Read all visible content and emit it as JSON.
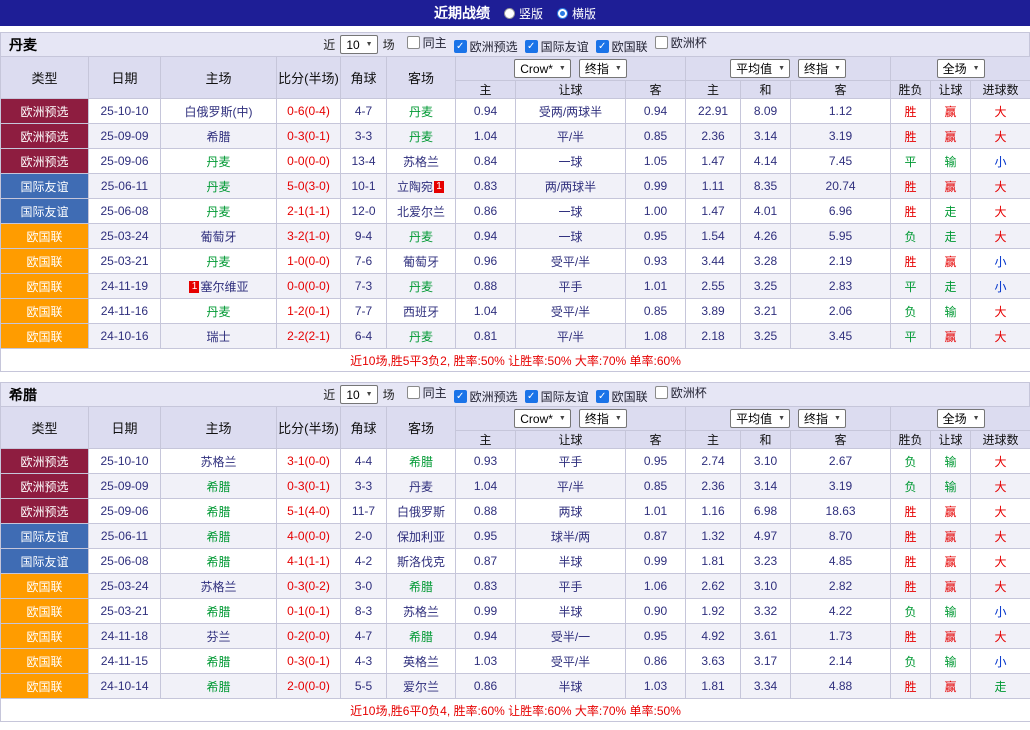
{
  "topbar": {
    "title": "近期战绩",
    "layout_options": [
      {
        "label": "竖版",
        "selected": false
      },
      {
        "label": "横版",
        "selected": true
      }
    ]
  },
  "table_head": {
    "type": "类型",
    "date": "日期",
    "home": "主场",
    "score": "比分(半场)",
    "corner": "角球",
    "away": "客场",
    "asia_selects": [
      "Crow*",
      "终指"
    ],
    "europe_selects": [
      "平均值",
      "终指"
    ],
    "result_select": "全场",
    "asia_sub": [
      "主",
      "让球",
      "客"
    ],
    "europe_sub": [
      "主",
      "和",
      "客"
    ],
    "result_sub": [
      "胜负",
      "让球",
      "进球数"
    ]
  },
  "colors": {
    "topbar_bg": "#1e1e96",
    "euro_qualifier_badge": "#8e1d40",
    "friendly_badge": "#3f6cb4",
    "nations_league_badge": "#ff9c00",
    "focus_team_green": "#009933",
    "score_red": "#e60000",
    "under_blue": "#0033cc"
  },
  "sections": [
    {
      "team": "丹麦",
      "filter": {
        "near": "近",
        "count": "10",
        "unit": "场",
        "checkboxes": [
          {
            "label": "同主",
            "checked": false
          },
          {
            "label": "欧洲预选",
            "checked": true
          },
          {
            "label": "国际友谊",
            "checked": true
          },
          {
            "label": "欧国联",
            "checked": true
          },
          {
            "label": "欧洲杯",
            "checked": false
          }
        ]
      },
      "rows": [
        {
          "league": "欧洲预选",
          "league_class": "eq",
          "date": "25-10-10",
          "home": "白俄罗斯(中)",
          "home_focus": false,
          "home_card": "",
          "score": "0-6(0-4)",
          "corner": "4-7",
          "away": "丹麦",
          "away_focus": true,
          "away_card": "",
          "asia": [
            "0.94",
            "受两/两球半",
            "0.94"
          ],
          "europe": [
            "22.91",
            "8.09",
            "1.12"
          ],
          "results": [
            [
              "胜",
              "red"
            ],
            [
              "赢",
              "red"
            ],
            [
              "大",
              "red"
            ]
          ]
        },
        {
          "league": "欧洲预选",
          "league_class": "eq",
          "date": "25-09-09",
          "home": "希腊",
          "home_focus": false,
          "home_card": "",
          "score": "0-3(0-1)",
          "corner": "3-3",
          "away": "丹麦",
          "away_focus": true,
          "away_card": "",
          "asia": [
            "1.04",
            "平/半",
            "0.85"
          ],
          "europe": [
            "2.36",
            "3.14",
            "3.19"
          ],
          "results": [
            [
              "胜",
              "red"
            ],
            [
              "赢",
              "red"
            ],
            [
              "大",
              "red"
            ]
          ]
        },
        {
          "league": "欧洲预选",
          "league_class": "eq",
          "date": "25-09-06",
          "home": "丹麦",
          "home_focus": true,
          "home_card": "",
          "score": "0-0(0-0)",
          "corner": "13-4",
          "away": "苏格兰",
          "away_focus": false,
          "away_card": "",
          "asia": [
            "0.84",
            "一球",
            "1.05"
          ],
          "europe": [
            "1.47",
            "4.14",
            "7.45"
          ],
          "results": [
            [
              "平",
              "green"
            ],
            [
              "输",
              "green"
            ],
            [
              "小",
              "blue"
            ]
          ]
        },
        {
          "league": "国际友谊",
          "league_class": "fr",
          "date": "25-06-11",
          "home": "丹麦",
          "home_focus": true,
          "home_card": "",
          "score": "5-0(3-0)",
          "corner": "10-1",
          "away": "立陶宛",
          "away_focus": false,
          "away_card": "1",
          "asia": [
            "0.83",
            "两/两球半",
            "0.99"
          ],
          "europe": [
            "1.11",
            "8.35",
            "20.74"
          ],
          "results": [
            [
              "胜",
              "red"
            ],
            [
              "赢",
              "red"
            ],
            [
              "大",
              "red"
            ]
          ]
        },
        {
          "league": "国际友谊",
          "league_class": "fr",
          "date": "25-06-08",
          "home": "丹麦",
          "home_focus": true,
          "home_card": "",
          "score": "2-1(1-1)",
          "corner": "12-0",
          "away": "北爱尔兰",
          "away_focus": false,
          "away_card": "",
          "asia": [
            "0.86",
            "一球",
            "1.00"
          ],
          "europe": [
            "1.47",
            "4.01",
            "6.96"
          ],
          "results": [
            [
              "胜",
              "red"
            ],
            [
              "走",
              "green"
            ],
            [
              "大",
              "red"
            ]
          ]
        },
        {
          "league": "欧国联",
          "league_class": "nl",
          "date": "25-03-24",
          "home": "葡萄牙",
          "home_focus": false,
          "home_card": "",
          "score": "3-2(1-0)",
          "corner": "9-4",
          "away": "丹麦",
          "away_focus": true,
          "away_card": "",
          "asia": [
            "0.94",
            "一球",
            "0.95"
          ],
          "europe": [
            "1.54",
            "4.26",
            "5.95"
          ],
          "results": [
            [
              "负",
              "green"
            ],
            [
              "走",
              "green"
            ],
            [
              "大",
              "red"
            ]
          ]
        },
        {
          "league": "欧国联",
          "league_class": "nl",
          "date": "25-03-21",
          "home": "丹麦",
          "home_focus": true,
          "home_card": "",
          "score": "1-0(0-0)",
          "corner": "7-6",
          "away": "葡萄牙",
          "away_focus": false,
          "away_card": "",
          "asia": [
            "0.96",
            "受平/半",
            "0.93"
          ],
          "europe": [
            "3.44",
            "3.28",
            "2.19"
          ],
          "results": [
            [
              "胜",
              "red"
            ],
            [
              "赢",
              "red"
            ],
            [
              "小",
              "blue"
            ]
          ]
        },
        {
          "league": "欧国联",
          "league_class": "nl",
          "date": "24-11-19",
          "home": "塞尔维亚",
          "home_focus": false,
          "home_card": "1",
          "score": "0-0(0-0)",
          "corner": "7-3",
          "away": "丹麦",
          "away_focus": true,
          "away_card": "",
          "asia": [
            "0.88",
            "平手",
            "1.01"
          ],
          "europe": [
            "2.55",
            "3.25",
            "2.83"
          ],
          "results": [
            [
              "平",
              "green"
            ],
            [
              "走",
              "green"
            ],
            [
              "小",
              "blue"
            ]
          ]
        },
        {
          "league": "欧国联",
          "league_class": "nl",
          "date": "24-11-16",
          "home": "丹麦",
          "home_focus": true,
          "home_card": "",
          "score": "1-2(0-1)",
          "corner": "7-7",
          "away": "西班牙",
          "away_focus": false,
          "away_card": "",
          "asia": [
            "1.04",
            "受平/半",
            "0.85"
          ],
          "europe": [
            "3.89",
            "3.21",
            "2.06"
          ],
          "results": [
            [
              "负",
              "green"
            ],
            [
              "输",
              "green"
            ],
            [
              "大",
              "red"
            ]
          ]
        },
        {
          "league": "欧国联",
          "league_class": "nl",
          "date": "24-10-16",
          "home": "瑞士",
          "home_focus": false,
          "home_card": "",
          "score": "2-2(2-1)",
          "corner": "6-4",
          "away": "丹麦",
          "away_focus": true,
          "away_card": "",
          "asia": [
            "0.81",
            "平/半",
            "1.08"
          ],
          "europe": [
            "2.18",
            "3.25",
            "3.45"
          ],
          "results": [
            [
              "平",
              "green"
            ],
            [
              "赢",
              "red"
            ],
            [
              "大",
              "red"
            ]
          ]
        }
      ],
      "summary": "近10场,胜5平3负2, 胜率:50% 让胜率:50% 大率:70% 单率:60%"
    },
    {
      "team": "希腊",
      "filter": {
        "near": "近",
        "count": "10",
        "unit": "场",
        "checkboxes": [
          {
            "label": "同主",
            "checked": false
          },
          {
            "label": "欧洲预选",
            "checked": true
          },
          {
            "label": "国际友谊",
            "checked": true
          },
          {
            "label": "欧国联",
            "checked": true
          },
          {
            "label": "欧洲杯",
            "checked": false
          }
        ]
      },
      "rows": [
        {
          "league": "欧洲预选",
          "league_class": "eq",
          "date": "25-10-10",
          "home": "苏格兰",
          "home_focus": false,
          "home_card": "",
          "score": "3-1(0-0)",
          "corner": "4-4",
          "away": "希腊",
          "away_focus": true,
          "away_card": "",
          "asia": [
            "0.93",
            "平手",
            "0.95"
          ],
          "europe": [
            "2.74",
            "3.10",
            "2.67"
          ],
          "results": [
            [
              "负",
              "green"
            ],
            [
              "输",
              "green"
            ],
            [
              "大",
              "red"
            ]
          ]
        },
        {
          "league": "欧洲预选",
          "league_class": "eq",
          "date": "25-09-09",
          "home": "希腊",
          "home_focus": true,
          "home_card": "",
          "score": "0-3(0-1)",
          "corner": "3-3",
          "away": "丹麦",
          "away_focus": false,
          "away_card": "",
          "asia": [
            "1.04",
            "平/半",
            "0.85"
          ],
          "europe": [
            "2.36",
            "3.14",
            "3.19"
          ],
          "results": [
            [
              "负",
              "green"
            ],
            [
              "输",
              "green"
            ],
            [
              "大",
              "red"
            ]
          ]
        },
        {
          "league": "欧洲预选",
          "league_class": "eq",
          "date": "25-09-06",
          "home": "希腊",
          "home_focus": true,
          "home_card": "",
          "score": "5-1(4-0)",
          "corner": "11-7",
          "away": "白俄罗斯",
          "away_focus": false,
          "away_card": "",
          "asia": [
            "0.88",
            "两球",
            "1.01"
          ],
          "europe": [
            "1.16",
            "6.98",
            "18.63"
          ],
          "results": [
            [
              "胜",
              "red"
            ],
            [
              "赢",
              "red"
            ],
            [
              "大",
              "red"
            ]
          ]
        },
        {
          "league": "国际友谊",
          "league_class": "fr",
          "date": "25-06-11",
          "home": "希腊",
          "home_focus": true,
          "home_card": "",
          "score": "4-0(0-0)",
          "corner": "2-0",
          "away": "保加利亚",
          "away_focus": false,
          "away_card": "",
          "asia": [
            "0.95",
            "球半/两",
            "0.87"
          ],
          "europe": [
            "1.32",
            "4.97",
            "8.70"
          ],
          "results": [
            [
              "胜",
              "red"
            ],
            [
              "赢",
              "red"
            ],
            [
              "大",
              "red"
            ]
          ]
        },
        {
          "league": "国际友谊",
          "league_class": "fr",
          "date": "25-06-08",
          "home": "希腊",
          "home_focus": true,
          "home_card": "",
          "score": "4-1(1-1)",
          "corner": "4-2",
          "away": "斯洛伐克",
          "away_focus": false,
          "away_card": "",
          "asia": [
            "0.87",
            "半球",
            "0.99"
          ],
          "europe": [
            "1.81",
            "3.23",
            "4.85"
          ],
          "results": [
            [
              "胜",
              "red"
            ],
            [
              "赢",
              "red"
            ],
            [
              "大",
              "red"
            ]
          ]
        },
        {
          "league": "欧国联",
          "league_class": "nl",
          "date": "25-03-24",
          "home": "苏格兰",
          "home_focus": false,
          "home_card": "",
          "score": "0-3(0-2)",
          "corner": "3-0",
          "away": "希腊",
          "away_focus": true,
          "away_card": "",
          "asia": [
            "0.83",
            "平手",
            "1.06"
          ],
          "europe": [
            "2.62",
            "3.10",
            "2.82"
          ],
          "results": [
            [
              "胜",
              "red"
            ],
            [
              "赢",
              "red"
            ],
            [
              "大",
              "red"
            ]
          ]
        },
        {
          "league": "欧国联",
          "league_class": "nl",
          "date": "25-03-21",
          "home": "希腊",
          "home_focus": true,
          "home_card": "",
          "score": "0-1(0-1)",
          "corner": "8-3",
          "away": "苏格兰",
          "away_focus": false,
          "away_card": "",
          "asia": [
            "0.99",
            "半球",
            "0.90"
          ],
          "europe": [
            "1.92",
            "3.32",
            "4.22"
          ],
          "results": [
            [
              "负",
              "green"
            ],
            [
              "输",
              "green"
            ],
            [
              "小",
              "blue"
            ]
          ]
        },
        {
          "league": "欧国联",
          "league_class": "nl",
          "date": "24-11-18",
          "home": "芬兰",
          "home_focus": false,
          "home_card": "",
          "score": "0-2(0-0)",
          "corner": "4-7",
          "away": "希腊",
          "away_focus": true,
          "away_card": "",
          "asia": [
            "0.94",
            "受半/一",
            "0.95"
          ],
          "europe": [
            "4.92",
            "3.61",
            "1.73"
          ],
          "results": [
            [
              "胜",
              "red"
            ],
            [
              "赢",
              "red"
            ],
            [
              "大",
              "red"
            ]
          ]
        },
        {
          "league": "欧国联",
          "league_class": "nl",
          "date": "24-11-15",
          "home": "希腊",
          "home_focus": true,
          "home_card": "",
          "score": "0-3(0-1)",
          "corner": "4-3",
          "away": "英格兰",
          "away_focus": false,
          "away_card": "",
          "asia": [
            "1.03",
            "受平/半",
            "0.86"
          ],
          "europe": [
            "3.63",
            "3.17",
            "2.14"
          ],
          "results": [
            [
              "负",
              "green"
            ],
            [
              "输",
              "green"
            ],
            [
              "小",
              "blue"
            ]
          ]
        },
        {
          "league": "欧国联",
          "league_class": "nl",
          "date": "24-10-14",
          "home": "希腊",
          "home_focus": true,
          "home_card": "",
          "score": "2-0(0-0)",
          "corner": "5-5",
          "away": "爱尔兰",
          "away_focus": false,
          "away_card": "",
          "asia": [
            "0.86",
            "半球",
            "1.03"
          ],
          "europe": [
            "1.81",
            "3.34",
            "4.88"
          ],
          "results": [
            [
              "胜",
              "red"
            ],
            [
              "赢",
              "red"
            ],
            [
              "走",
              "green"
            ]
          ]
        }
      ],
      "summary": "近10场,胜6平0负4, 胜率:60% 让胜率:60% 大率:70% 单率:50%"
    }
  ]
}
